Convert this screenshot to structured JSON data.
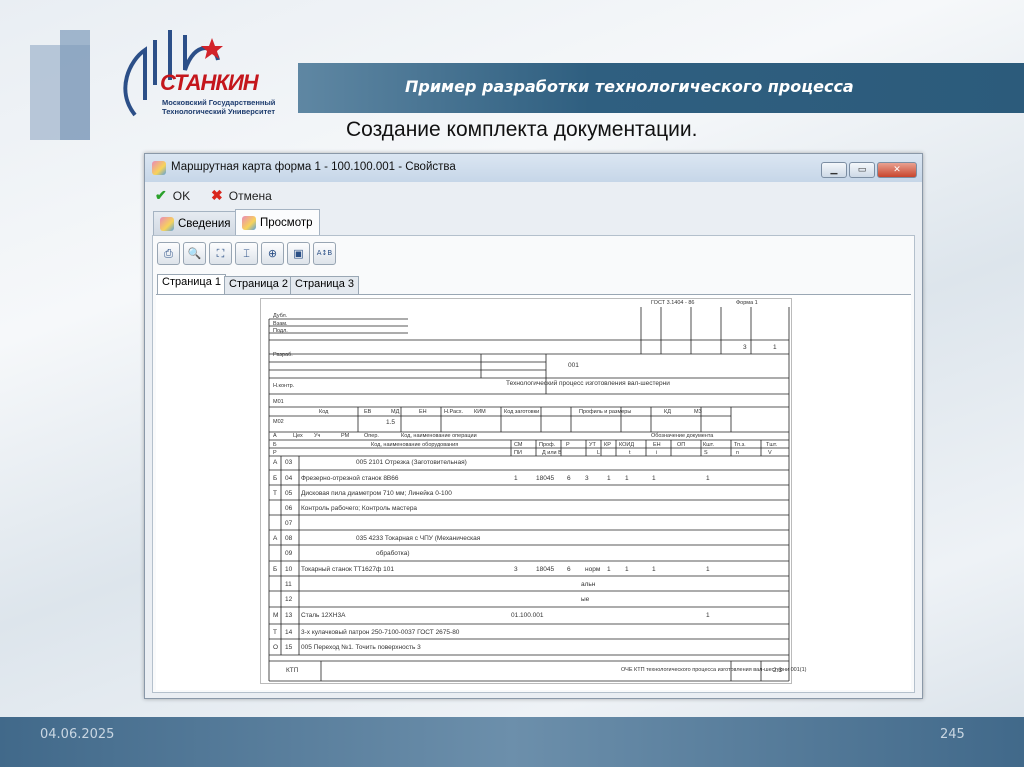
{
  "slide": {
    "title": "Пример разработки технологического процесса",
    "subtitle": "Создание комплекта документации.",
    "date": "04.06.2025",
    "page": "245",
    "logo": {
      "name": "СТАНКИН",
      "line1": "Московский Государственный",
      "line2": "Технологический Университет"
    }
  },
  "window": {
    "title": "Маршрутная карта форма 1 - 100.100.001 - Свойства",
    "ok": "OK",
    "cancel": "Отмена",
    "tabs": [
      {
        "label": "Сведения"
      },
      {
        "label": "Просмотр",
        "active": true
      }
    ],
    "tools": [
      {
        "icon": "print-icon",
        "glyph": "⎙"
      },
      {
        "icon": "zoom-page-icon",
        "glyph": "🔍"
      },
      {
        "icon": "fit-page-icon",
        "glyph": "⛶"
      },
      {
        "icon": "fit-width-icon",
        "glyph": "⌶"
      },
      {
        "icon": "zoom-icon",
        "glyph": "⊕"
      },
      {
        "icon": "settings-icon",
        "glyph": "▣"
      },
      {
        "icon": "sort-icon",
        "glyph": "A↕B"
      }
    ],
    "pages": [
      "Страница 1",
      "Страница 2",
      "Страница 3"
    ]
  },
  "doc": {
    "gost": "ГОСТ 3.1404 - 86",
    "form": "Форма 1",
    "dubl": "Дубл.",
    "vzam": "Взам.",
    "podl": "Подл.",
    "sheets": "3",
    "sheet": "1",
    "razrab": "Разраб.",
    "code": "001",
    "nkontr": "Н.контр.",
    "process": "Технологический процесс изготовления вал-шестерни",
    "m01": "М01",
    "m02": "М02",
    "m02_value": "1.5",
    "mat_headers": [
      "Код",
      "ЕВ",
      "МД",
      "ЕН",
      "Н.Расх.",
      "КИМ",
      "Код заготовки",
      "Профиль и размеры",
      "КД",
      "МЗ"
    ],
    "headA": [
      "А",
      "Цех",
      "Уч",
      "РМ",
      "Опер.",
      "Код, наименование операции",
      "Обозначение документа"
    ],
    "headB": [
      "Б",
      "Код, наименование оборудования",
      "СМ",
      "Проф.",
      "Р",
      "УТ",
      "КР",
      "КОИД",
      "ЕН",
      "ОП",
      "Кшт.",
      "Тп.з.",
      "Тшт."
    ],
    "headR": [
      "Р",
      "ПИ",
      "Д или В",
      "L",
      "t",
      "i",
      "S",
      "n",
      "V"
    ],
    "rows": [
      {
        "p": "А",
        "n": "03",
        "text": "005   2101 Отрезка (Заготовительная)",
        "indent": 1,
        "values": []
      },
      {
        "p": "Б",
        "n": "04",
        "text": "Фрезерно-отрезной станок 8В66",
        "indent": 0,
        "values": [
          "1",
          "18045",
          "6",
          "3",
          "1",
          "1",
          "1",
          "1"
        ]
      },
      {
        "p": "Т",
        "n": "05",
        "text": "Дисковая пила диаметром 710 мм;  Линейка 0-100",
        "indent": 0,
        "values": []
      },
      {
        "p": "",
        "n": "06",
        "text": "Контроль рабочего; Контроль мастера",
        "indent": 0,
        "values": []
      },
      {
        "p": "",
        "n": "07",
        "text": "",
        "indent": 0,
        "values": []
      },
      {
        "p": "А",
        "n": "08",
        "text": "035   4233 Токарная с ЧПУ (Механическая",
        "indent": 1,
        "values": []
      },
      {
        "p": "",
        "n": "09",
        "text": "обработка)",
        "indent": 2,
        "values": []
      },
      {
        "p": "Б",
        "n": "10",
        "text": "Токарный станок ТТ1627ф 101",
        "indent": 0,
        "values": [
          "3",
          "18045",
          "6",
          "норм",
          "1",
          "1",
          "1",
          "1"
        ]
      },
      {
        "p": "",
        "n": "11",
        "text": "альн",
        "indent": 3,
        "values": []
      },
      {
        "p": "",
        "n": "12",
        "text": "ые",
        "indent": 3,
        "values": []
      },
      {
        "p": "М",
        "n": "13",
        "text": "Сталь 12ХН3А",
        "indent": 0,
        "doc": "01.100.001",
        "values": [
          "",
          "",
          "",
          "",
          "",
          "",
          "",
          "1"
        ]
      },
      {
        "p": "Т",
        "n": "14",
        "text": "3-х кулачковый патрон 250-7100-0037 ГОСТ 2675-80",
        "indent": 0,
        "values": []
      },
      {
        "p": "О",
        "n": "15",
        "text": "005   Переход №1. Точить поверхность 3",
        "indent": 0,
        "values": []
      }
    ],
    "footer": {
      "ktp": "КТП",
      "name": "ОЧЕ КТП технологического процесса изготовления вал-шестерни 001(1)",
      "num": "2.3"
    }
  }
}
